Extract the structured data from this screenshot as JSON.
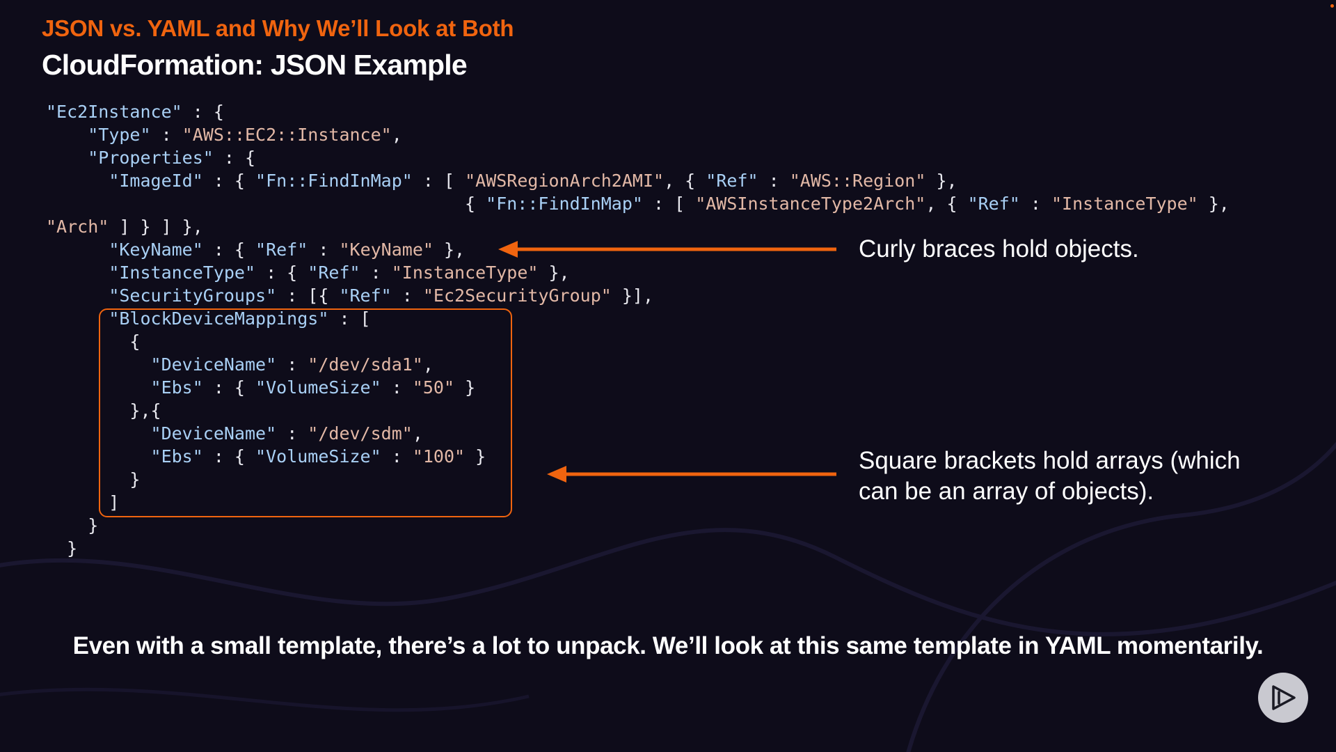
{
  "slide": {
    "kicker": "JSON vs. YAML and Why We’ll Look at Both",
    "title": "CloudFormation: JSON Example",
    "footer": "Even with a small template, there’s a lot to unpack. We’ll look at this same template in YAML momentarily."
  },
  "code_lines": [
    [
      [
        "k",
        "\"Ec2Instance\""
      ],
      [
        "p",
        " : {"
      ]
    ],
    [
      [
        "p",
        "    "
      ],
      [
        "k",
        "\"Type\""
      ],
      [
        "p",
        " : "
      ],
      [
        "s",
        "\"AWS::EC2::Instance\""
      ],
      [
        "p",
        ","
      ]
    ],
    [
      [
        "p",
        "    "
      ],
      [
        "k",
        "\"Properties\""
      ],
      [
        "p",
        " : {"
      ]
    ],
    [
      [
        "p",
        "      "
      ],
      [
        "k",
        "\"ImageId\""
      ],
      [
        "p",
        " : { "
      ],
      [
        "k",
        "\"Fn::FindInMap\""
      ],
      [
        "p",
        " : [ "
      ],
      [
        "s",
        "\"AWSRegionArch2AMI\""
      ],
      [
        "p",
        ", { "
      ],
      [
        "k",
        "\"Ref\""
      ],
      [
        "p",
        " : "
      ],
      [
        "s",
        "\"AWS::Region\""
      ],
      [
        "p",
        " },"
      ]
    ],
    [
      [
        "p",
        "                                        { "
      ],
      [
        "k",
        "\"Fn::FindInMap\""
      ],
      [
        "p",
        " : [ "
      ],
      [
        "s",
        "\"AWSInstanceType2Arch\""
      ],
      [
        "p",
        ", { "
      ],
      [
        "k",
        "\"Ref\""
      ],
      [
        "p",
        " : "
      ],
      [
        "s",
        "\"InstanceType\""
      ],
      [
        "p",
        " },"
      ]
    ],
    [
      [
        "s",
        "\"Arch\""
      ],
      [
        "p",
        " ] } ] },"
      ]
    ],
    [
      [
        "p",
        "      "
      ],
      [
        "k",
        "\"KeyName\""
      ],
      [
        "p",
        " : { "
      ],
      [
        "k",
        "\"Ref\""
      ],
      [
        "p",
        " : "
      ],
      [
        "s",
        "\"KeyName\""
      ],
      [
        "p",
        " },"
      ]
    ],
    [
      [
        "p",
        "      "
      ],
      [
        "k",
        "\"InstanceType\""
      ],
      [
        "p",
        " : { "
      ],
      [
        "k",
        "\"Ref\""
      ],
      [
        "p",
        " : "
      ],
      [
        "s",
        "\"InstanceType\""
      ],
      [
        "p",
        " },"
      ]
    ],
    [
      [
        "p",
        "      "
      ],
      [
        "k",
        "\"SecurityGroups\""
      ],
      [
        "p",
        " : [{ "
      ],
      [
        "k",
        "\"Ref\""
      ],
      [
        "p",
        " : "
      ],
      [
        "s",
        "\"Ec2SecurityGroup\""
      ],
      [
        "p",
        " }],"
      ]
    ],
    [
      [
        "p",
        "      "
      ],
      [
        "k",
        "\"BlockDeviceMappings\""
      ],
      [
        "p",
        " : ["
      ]
    ],
    [
      [
        "p",
        "        {"
      ]
    ],
    [
      [
        "p",
        "          "
      ],
      [
        "k",
        "\"DeviceName\""
      ],
      [
        "p",
        " : "
      ],
      [
        "s",
        "\"/dev/sda1\""
      ],
      [
        "p",
        ","
      ]
    ],
    [
      [
        "p",
        "          "
      ],
      [
        "k",
        "\"Ebs\""
      ],
      [
        "p",
        " : { "
      ],
      [
        "k",
        "\"VolumeSize\""
      ],
      [
        "p",
        " : "
      ],
      [
        "s",
        "\"50\""
      ],
      [
        "p",
        " }"
      ]
    ],
    [
      [
        "p",
        "        },{"
      ]
    ],
    [
      [
        "p",
        "          "
      ],
      [
        "k",
        "\"DeviceName\""
      ],
      [
        "p",
        " : "
      ],
      [
        "s",
        "\"/dev/sdm\""
      ],
      [
        "p",
        ","
      ]
    ],
    [
      [
        "p",
        "          "
      ],
      [
        "k",
        "\"Ebs\""
      ],
      [
        "p",
        " : { "
      ],
      [
        "k",
        "\"VolumeSize\""
      ],
      [
        "p",
        " : "
      ],
      [
        "s",
        "\"100\""
      ],
      [
        "p",
        " }"
      ]
    ],
    [
      [
        "p",
        "        }"
      ]
    ],
    [
      [
        "p",
        "      ]"
      ]
    ],
    [
      [
        "p",
        "    }"
      ]
    ],
    [
      [
        "p",
        "  }"
      ]
    ]
  ],
  "callouts": {
    "objects": "Curly braces hold objects.",
    "arrays_line1": "Square brackets hold arrays (which",
    "arrays_line2": "can be an array of objects)."
  },
  "colors": {
    "accent": "#f0640f",
    "background": "#0e0c1a",
    "code_key": "#a9d0f5",
    "code_string": "#e2b8a6"
  },
  "icons": {
    "play": "play-icon"
  }
}
